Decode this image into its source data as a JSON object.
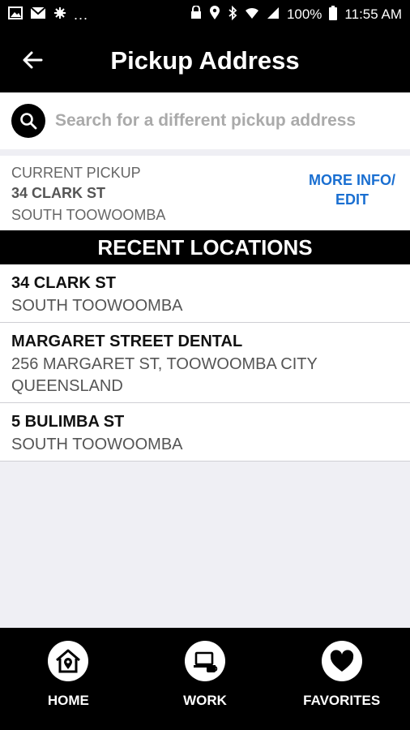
{
  "status_bar": {
    "battery_percent": "100%",
    "time": "11:55 AM",
    "dots": "...",
    "left_icons": [
      "image-icon",
      "mail-icon",
      "settings-notification-icon"
    ],
    "right_icons": [
      "lock-icon",
      "location-icon",
      "bluetooth-icon",
      "wifi-icon",
      "signal-icon",
      "battery-icon"
    ]
  },
  "header": {
    "title": "Pickup Address",
    "back_icon": "arrow-left-icon"
  },
  "search": {
    "placeholder": "Search for a different pickup address",
    "value": ""
  },
  "current_pickup": {
    "label": "CURRENT PICKUP",
    "street": "34 CLARK ST",
    "suburb": "SOUTH TOOWOOMBA",
    "more_info_line1": "MORE INFO/",
    "more_info_line2": "EDIT"
  },
  "recent": {
    "header": "RECENT LOCATIONS",
    "items": [
      {
        "title": "34 CLARK ST",
        "line1": "SOUTH TOOWOOMBA",
        "line2": ""
      },
      {
        "title": "MARGARET STREET DENTAL",
        "line1": "256 MARGARET ST, TOOWOOMBA CITY",
        "line2": "QUEENSLAND"
      },
      {
        "title": "5 BULIMBA ST",
        "line1": "SOUTH TOOWOOMBA",
        "line2": ""
      }
    ]
  },
  "bottom_nav": {
    "items": [
      {
        "label": "HOME",
        "icon": "home-location-icon"
      },
      {
        "label": "WORK",
        "icon": "work-laptop-icon"
      },
      {
        "label": "FAVORITES",
        "icon": "heart-icon"
      }
    ]
  },
  "colors": {
    "accent_link": "#1a6fd1",
    "bar_background": "#000000",
    "page_background": "#efeff4"
  }
}
